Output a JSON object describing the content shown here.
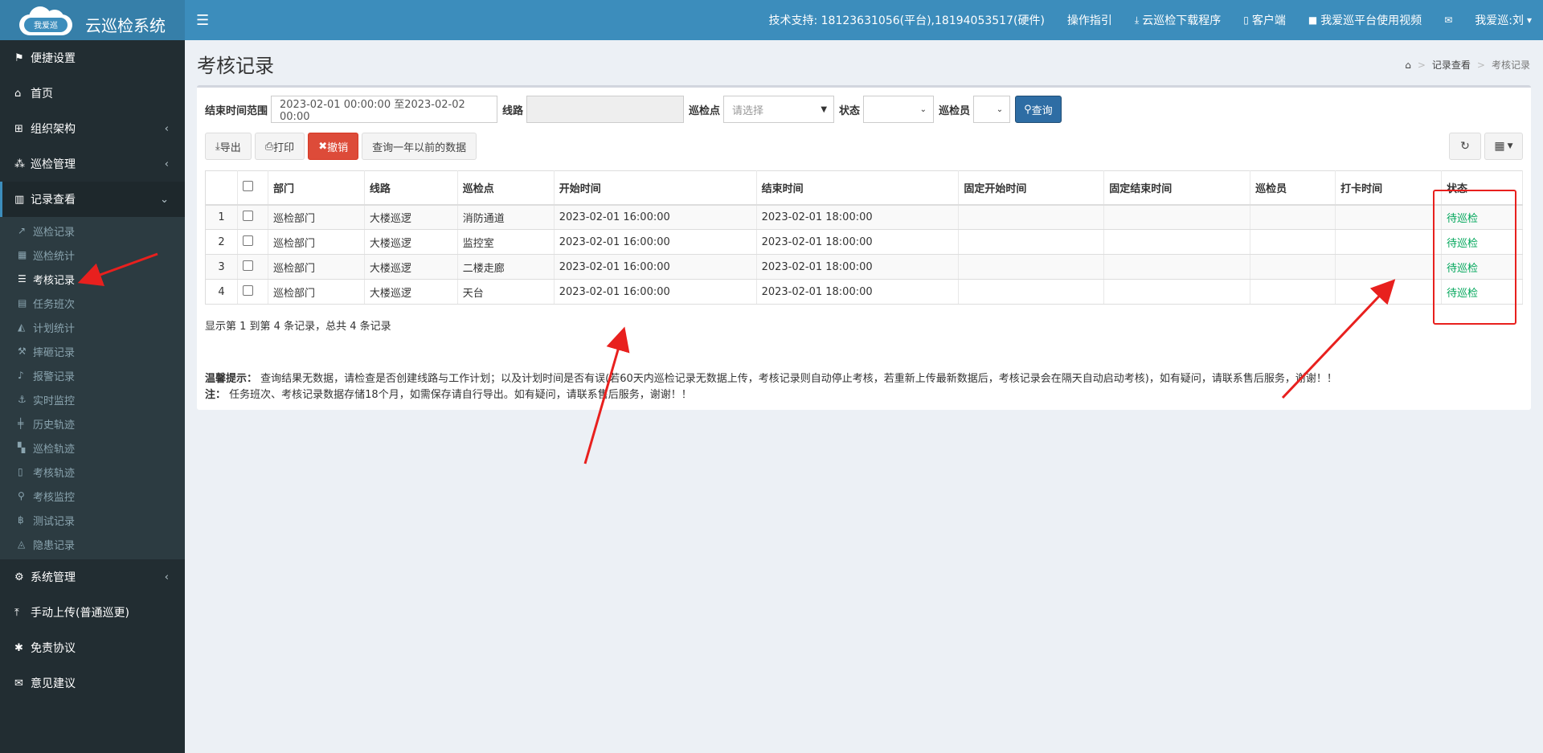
{
  "header": {
    "logo_badge": "我爱巡",
    "app_name": "云巡检系统",
    "menu_toggle_icon": "hamburger-icon",
    "nav": [
      {
        "label": "技术支持: 18123631056(平台),18194053517(硬件)",
        "icon": ""
      },
      {
        "label": "操作指引",
        "icon": ""
      },
      {
        "label": "云巡检下载程序",
        "icon": "download-icon"
      },
      {
        "label": "客户端",
        "icon": "mobile-icon"
      },
      {
        "label": "我爱巡平台使用视频",
        "icon": "video-icon"
      },
      {
        "label": "",
        "icon": "envelope-icon"
      },
      {
        "label": "我爱巡:刘",
        "icon": "caret-down-icon"
      }
    ]
  },
  "sidebar": {
    "items": [
      {
        "label": "便捷设置",
        "icon": "flag-icon"
      },
      {
        "label": "首页",
        "icon": "home-icon"
      },
      {
        "label": "组织架构",
        "icon": "sitemap-icon",
        "arrow": "‹"
      },
      {
        "label": "巡检管理",
        "icon": "road-icon",
        "arrow": "‹"
      },
      {
        "label": "记录查看",
        "icon": "bar-chart-icon",
        "arrow": "⌄"
      }
    ],
    "subitems": [
      {
        "label": "巡检记录",
        "icon": "line-chart-icon"
      },
      {
        "label": "巡检统计",
        "icon": "table-icon"
      },
      {
        "label": "考核记录",
        "icon": "list-icon"
      },
      {
        "label": "任务班次",
        "icon": "calendar-icon"
      },
      {
        "label": "计划统计",
        "icon": "area-chart-icon"
      },
      {
        "label": "摔砸记录",
        "icon": "gavel-icon"
      },
      {
        "label": "报警记录",
        "icon": "bell-icon"
      },
      {
        "label": "实时监控",
        "icon": "anchor-icon"
      },
      {
        "label": "历史轨迹",
        "icon": "signpost-icon"
      },
      {
        "label": "巡检轨迹",
        "icon": "map-icon"
      },
      {
        "label": "考核轨迹",
        "icon": "map-outline-icon"
      },
      {
        "label": "考核监控",
        "icon": "map-marker-icon"
      },
      {
        "label": "测试记录",
        "icon": "bitcoin-icon"
      },
      {
        "label": "隐患记录",
        "icon": "bell-outline-icon"
      }
    ],
    "bottom_items": [
      {
        "label": "系统管理",
        "icon": "cog-icon",
        "arrow": "‹"
      },
      {
        "label": "手动上传(普通巡更)",
        "icon": "upload-icon"
      },
      {
        "label": "免责协议",
        "icon": "asterisk-icon"
      },
      {
        "label": "意见建议",
        "icon": "envelope-open-icon"
      }
    ]
  },
  "page": {
    "title": "考核记录",
    "breadcrumb": [
      "记录查看",
      "考核记录"
    ]
  },
  "filters": {
    "end_time_label": "结束时间范围",
    "end_time_value": "2023-02-01 00:00:00 至2023-02-02 00:00",
    "route_label": "线路",
    "route_value": "",
    "point_label": "巡检点",
    "point_placeholder": "请选择",
    "status_label": "状态",
    "status_value": "",
    "inspector_label": "巡检员",
    "inspector_value": "",
    "query_button": "查询"
  },
  "toolbar": {
    "export": "导出",
    "print": "打印",
    "revoke": "撤销",
    "query_old": "查询一年以前的数据"
  },
  "table": {
    "columns": [
      "",
      "",
      "部门",
      "线路",
      "巡检点",
      "开始时间",
      "结束时间",
      "固定开始时间",
      "固定结束时间",
      "巡检员",
      "打卡时间",
      "状态"
    ],
    "rows": [
      {
        "no": "1",
        "dept": "巡检部门",
        "route": "大楼巡逻",
        "point": "消防通道",
        "start": "2023-02-01 16:00:00",
        "end": "2023-02-01 18:00:00",
        "fixed_start": "",
        "fixed_end": "",
        "inspector": "",
        "punch": "",
        "status": "待巡检"
      },
      {
        "no": "2",
        "dept": "巡检部门",
        "route": "大楼巡逻",
        "point": "监控室",
        "start": "2023-02-01 16:00:00",
        "end": "2023-02-01 18:00:00",
        "fixed_start": "",
        "fixed_end": "",
        "inspector": "",
        "punch": "",
        "status": "待巡检"
      },
      {
        "no": "3",
        "dept": "巡检部门",
        "route": "大楼巡逻",
        "point": "二楼走廊",
        "start": "2023-02-01 16:00:00",
        "end": "2023-02-01 18:00:00",
        "fixed_start": "",
        "fixed_end": "",
        "inspector": "",
        "punch": "",
        "status": "待巡检"
      },
      {
        "no": "4",
        "dept": "巡检部门",
        "route": "大楼巡逻",
        "point": "天台",
        "start": "2023-02-01 16:00:00",
        "end": "2023-02-01 18:00:00",
        "fixed_start": "",
        "fixed_end": "",
        "inspector": "",
        "punch": "",
        "status": "待巡检"
      }
    ]
  },
  "pagination": {
    "info": "显示第 1 到第 4 条记录，总共 4 条记录"
  },
  "notes": {
    "tip_label": "温馨提示：",
    "tip_text": "查询结果无数据，请检查是否创建线路与工作计划；以及计划时间是否有误(若60天内巡检记录无数据上传，考核记录则自动停止考核，若重新上传最新数据后，考核记录会在隔天自动启动考核)，如有疑问，请联系售后服务，谢谢！！",
    "note_label": "注：",
    "note_text": "任务班次、考核记录数据存储18个月，如需保存请自行导出。如有疑问，请联系售后服务，谢谢！！"
  },
  "colors": {
    "header": "#3c8dbc",
    "sidebar": "#222d32",
    "status_pending": "#00a65a",
    "annotation": "#e8201e"
  }
}
